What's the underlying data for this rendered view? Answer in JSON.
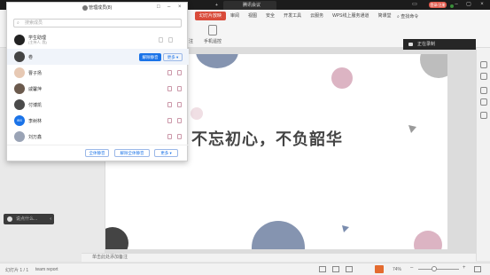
{
  "topbar": {
    "meeting_tab": "腾讯会议",
    "register_label": "登录/注册",
    "plus": "+"
  },
  "ribbon": {
    "menu": [
      "幻灯片放映",
      "审阅",
      "视图",
      "安全",
      "开发工具",
      "云服务",
      "WPS线上服务通道",
      "简课堂"
    ],
    "active_index": 0,
    "search_label": "查找命令",
    "tool1": "注",
    "tool2": "手机遥控"
  },
  "panel": {
    "title": "管理成员(8)",
    "search_placeholder": "搜索成员",
    "host": {
      "name": "学生助理",
      "role": "(主持人, 我)"
    },
    "members": [
      {
        "name": "卷",
        "button": "解除静音",
        "more": "更多 ▾"
      },
      {
        "name": "曹子扬"
      },
      {
        "name": "戚馨萍"
      },
      {
        "name": "付博凯"
      },
      {
        "name": "李树林",
        "avatar_text": "IBS"
      },
      {
        "name": "刘万鑫"
      }
    ],
    "footer": {
      "mute_all": "全体静音",
      "unmute_all": "解除全体静音",
      "more": "更多 ▾"
    }
  },
  "float_bar": {
    "label": "说点什么..."
  },
  "recording": {
    "label": "正在录制"
  },
  "slide": {
    "title": "不忘初心，不负韶华"
  },
  "notes": {
    "placeholder": "单击此处添加备注"
  },
  "status": {
    "slide_info": "幻灯片 1 / 1",
    "theme": "team report",
    "zoom": "74%"
  },
  "colors": {
    "accent": "#d94b3a",
    "button_blue": "#1a73e8",
    "circle_blue": "#8594b0",
    "circle_pink": "#dcb4c3",
    "circle_gray": "#bdbdbd"
  }
}
